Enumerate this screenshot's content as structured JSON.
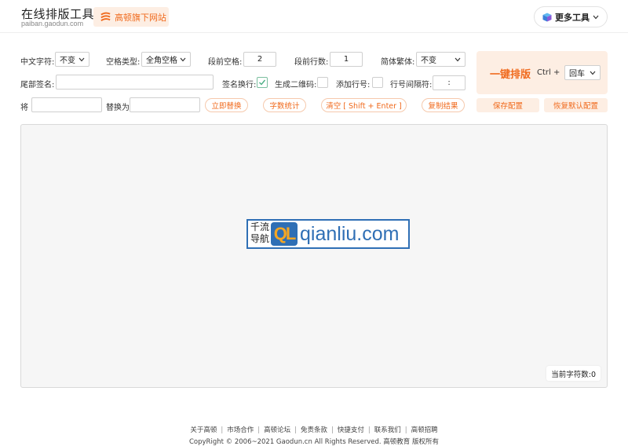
{
  "header": {
    "title": "在线排版工具",
    "domain": "paiban.gaodun.com",
    "brand_badge": "高顿旗下网站",
    "more_tools": "更多工具",
    "brand_color": "#f06a1d"
  },
  "row1": {
    "chinese_char_label": "中文字符:",
    "chinese_char_value": "不变",
    "space_type_label": "空格类型:",
    "space_type_value": "全角空格",
    "para_space_label": "段前空格:",
    "para_space_value": "2",
    "para_lines_label": "段前行数:",
    "para_lines_value": "1",
    "simp_trad_label": "简体繁体:",
    "simp_trad_value": "不变"
  },
  "row2": {
    "tail_sign_label": "尾部签名:",
    "tail_sign_value": "",
    "sign_newline_label": "签名换行:",
    "sign_newline_checked": true,
    "qrcode_label": "生成二维码:",
    "qrcode_checked": false,
    "line_no_label": "添加行号:",
    "line_no_checked": false,
    "line_sep_label": "行号间隔符:",
    "line_sep_value": ":"
  },
  "row3": {
    "replace_from_label": "将",
    "replace_from_value": "",
    "replace_to_label": "替换为",
    "replace_to_value": "",
    "replace_now": "立即替换",
    "word_count": "字数统计",
    "clear": "清空 [ Shift + Enter ]",
    "copy_result": "复制结果",
    "save_config": "保存配置",
    "restore_default": "恢复默认配置"
  },
  "main_panel": {
    "one_click": "一键排版",
    "shortcut_prefix": "Ctrl +",
    "shortcut_key": "回车"
  },
  "editor": {
    "watermark_cn_line1": "千流",
    "watermark_cn_line2": "导航",
    "watermark_ql": "QL",
    "watermark_domain": "qianliu.com",
    "char_count": "当前字符数:0"
  },
  "footer": {
    "links": [
      "关于高顿",
      "市场合作",
      "高顿论坛",
      "免责条款",
      "快捷支付",
      "联系我们",
      "高顿招聘"
    ],
    "copyright": "CopyRight © 2006~2021 Gaodun.cn All Rights Reserved. 高顿教育 版权所有"
  }
}
